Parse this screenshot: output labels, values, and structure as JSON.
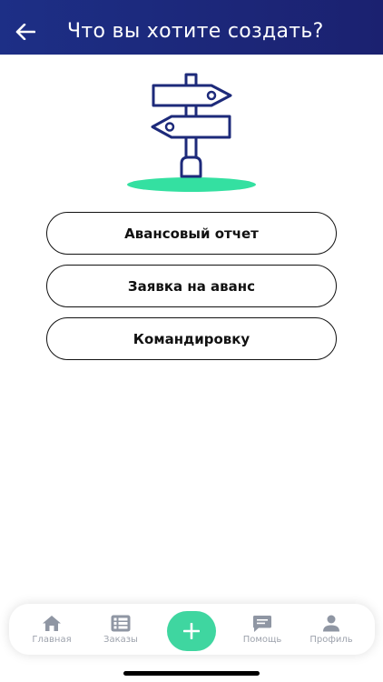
{
  "header": {
    "title": "Что вы хотите создать?",
    "back_icon": "arrow-left-icon",
    "background": "#1d2f86"
  },
  "illustration": {
    "icon": "signpost-icon",
    "stroke_color": "#1d2a7a",
    "ground_color": "#34e0a1"
  },
  "options": [
    {
      "label": "Авансовый отчет"
    },
    {
      "label": "Заявка на аванс"
    },
    {
      "label": "Командировку"
    }
  ],
  "tabbar": {
    "accent": "#3fd6a0",
    "items": [
      {
        "label": "Главная",
        "icon": "home-icon"
      },
      {
        "label": "Заказы",
        "icon": "list-icon"
      },
      {
        "label": "",
        "icon": "plus-icon"
      },
      {
        "label": "Помощь",
        "icon": "chat-icon"
      },
      {
        "label": "Профиль",
        "icon": "user-icon"
      }
    ]
  }
}
